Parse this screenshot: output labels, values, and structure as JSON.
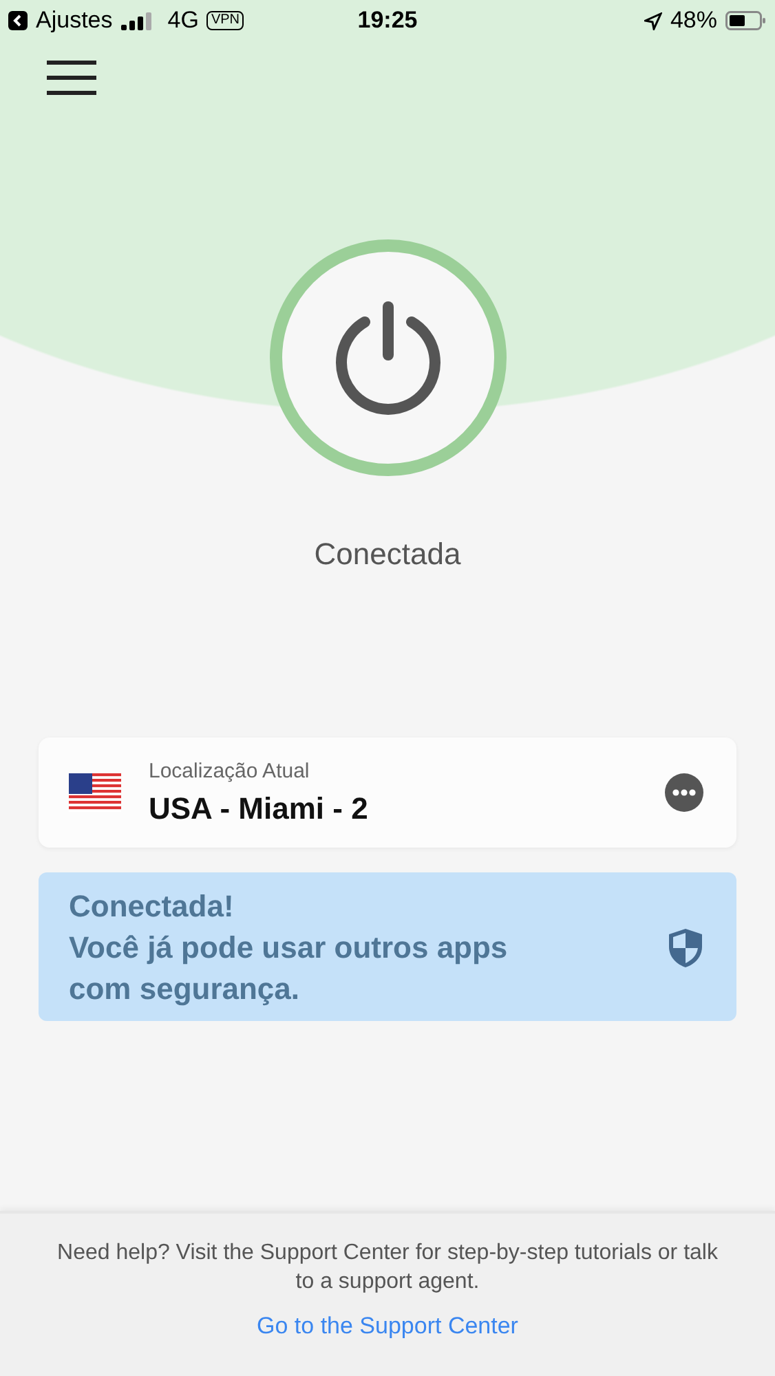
{
  "status_bar": {
    "back_label": "Ajustes",
    "network": "4G",
    "vpn_badge": "VPN",
    "time": "19:25",
    "battery_percent": "48%"
  },
  "connection": {
    "label": "Conectada",
    "connected": true
  },
  "location_card": {
    "caption": "Localização Atual",
    "name": "USA - Miami - 2"
  },
  "banner": {
    "title": "Conectada!",
    "message_lines": [
      "Você já pode usar outros apps",
      "com segurança."
    ]
  },
  "footer": {
    "help_text": "Need help? Visit the Support Center for step-by-step tutorials or talk to a support agent.",
    "link": "Go to the Support Center"
  }
}
